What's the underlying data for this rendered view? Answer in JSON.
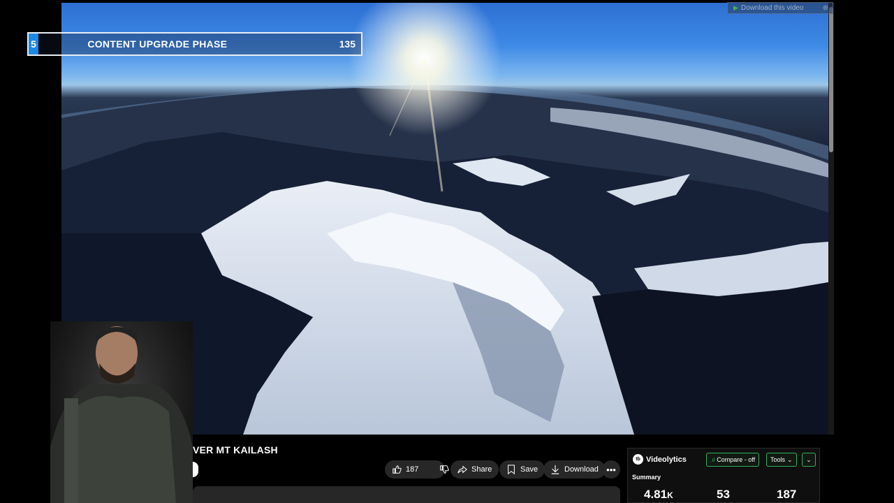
{
  "overlay": {
    "phase_number": "5",
    "phase_title": "CONTENT UPGRADE PHASE",
    "phase_count": "135",
    "download_banner": "Download this video"
  },
  "video": {
    "title": "VER MT KAILASH"
  },
  "actions": {
    "likes": "187",
    "share": "Share",
    "save": "Save",
    "download": "Download",
    "more_icon": "more-icon"
  },
  "videolytics": {
    "brand": "Videolytics",
    "logo": "tb",
    "compare": "Compare - off",
    "tools": "Tools",
    "summary": "Summary",
    "stats": [
      "4.81",
      "K",
      "53",
      "187"
    ]
  },
  "colors": {
    "accent_green": "#2fb35d",
    "phase_blue": "#1e88e5",
    "button_bg": "#272727"
  }
}
